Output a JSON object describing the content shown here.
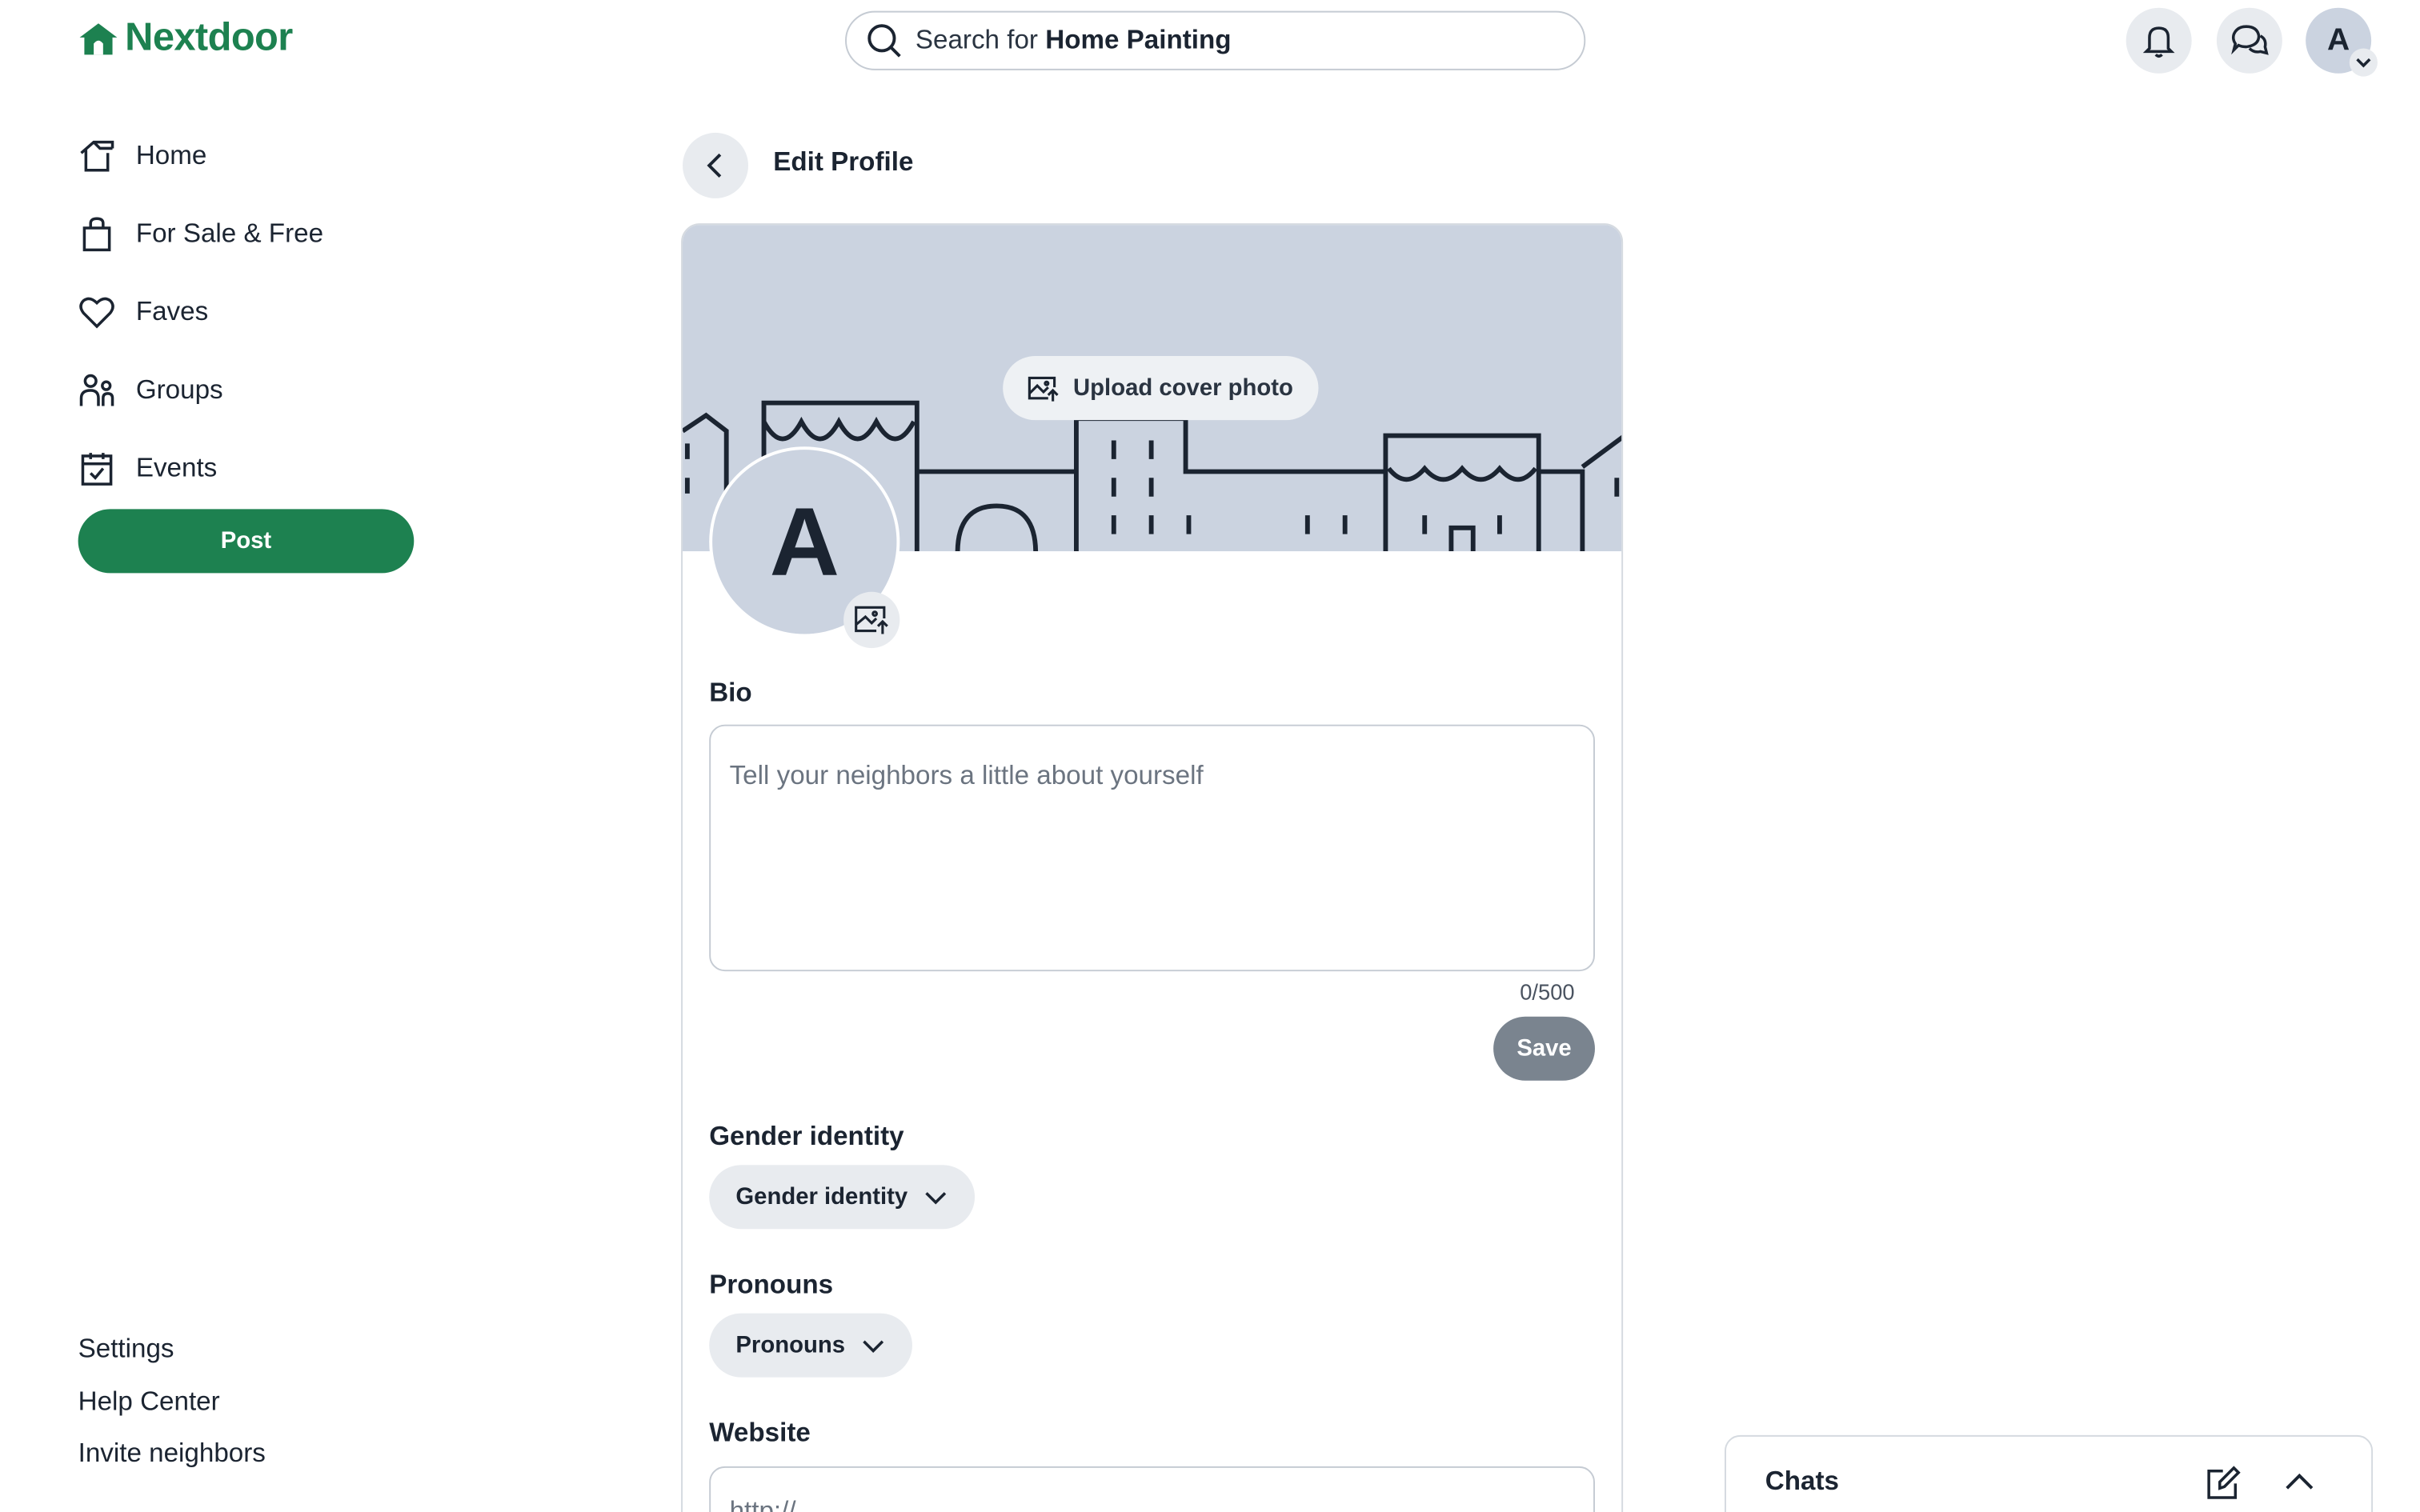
{
  "app": {
    "logo_text": "Nextdoor",
    "brand_color": "#1d8150"
  },
  "header": {
    "search_prefix": "Search for",
    "search_term": "Home Painting",
    "avatar_letter": "A",
    "icons": [
      "search-icon",
      "bell-icon",
      "chat-bubbles-icon",
      "chevron-down-icon"
    ]
  },
  "sidebar": {
    "items": [
      {
        "label": "Home",
        "icon": "home-icon"
      },
      {
        "label": "For Sale & Free",
        "icon": "shopping-bag-icon"
      },
      {
        "label": "Faves",
        "icon": "heart-icon"
      },
      {
        "label": "Groups",
        "icon": "groups-icon"
      },
      {
        "label": "Events",
        "icon": "calendar-icon"
      }
    ],
    "post_label": "Post",
    "footer_links": [
      "Settings",
      "Help Center",
      "Invite neighbors"
    ]
  },
  "main": {
    "title": "Edit Profile",
    "upload_cover_label": "Upload cover photo",
    "avatar_letter": "A",
    "bio": {
      "label": "Bio",
      "placeholder": "Tell your neighbors a little about yourself",
      "counter": "0/500",
      "save_label": "Save"
    },
    "gender": {
      "label": "Gender identity",
      "value": "Gender identity"
    },
    "pronouns": {
      "label": "Pronouns",
      "value": "Pronouns"
    },
    "website": {
      "label": "Website",
      "placeholder": "http://"
    }
  },
  "chats": {
    "title": "Chats"
  }
}
